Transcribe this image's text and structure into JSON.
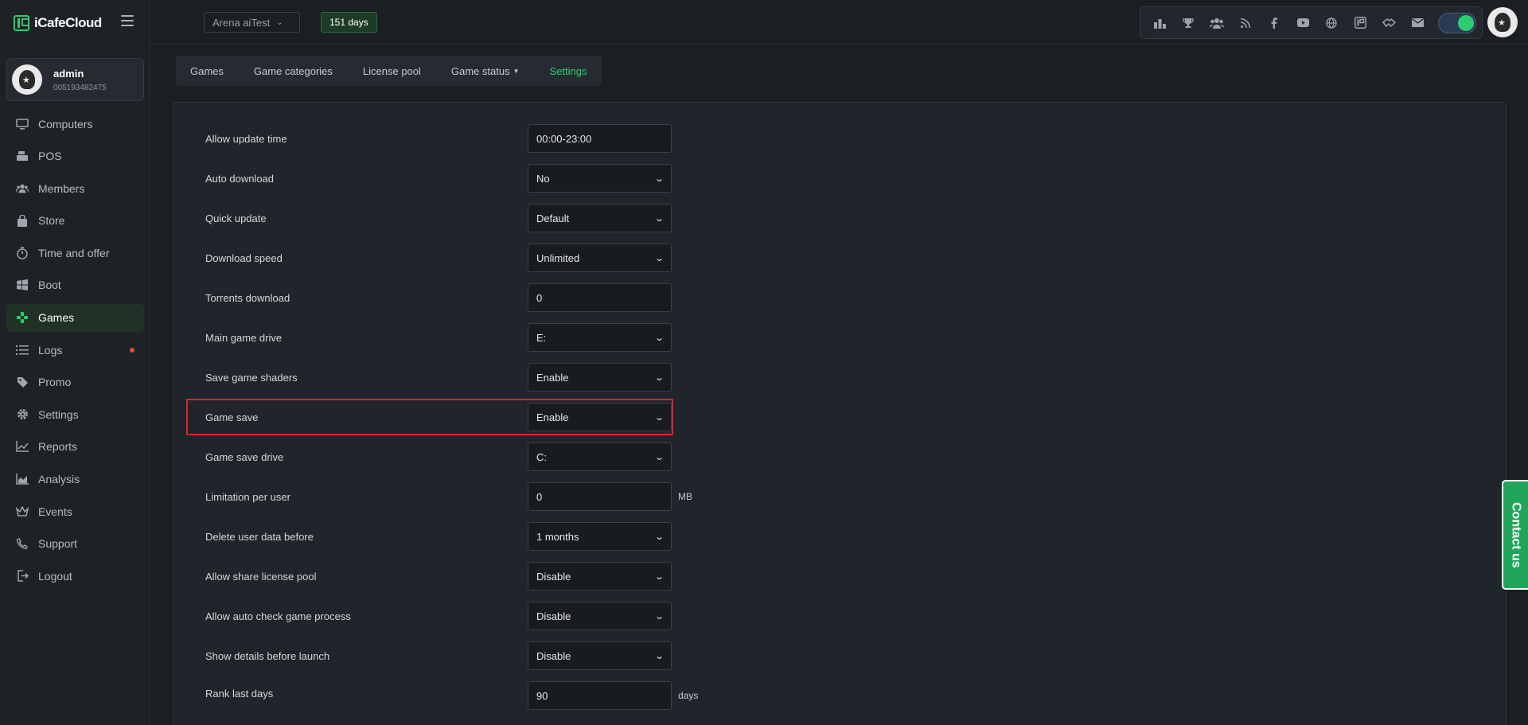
{
  "app": {
    "logo_text": "iCafeCloud"
  },
  "user": {
    "name": "admin",
    "id": "005193482475"
  },
  "sidebar": {
    "items": [
      {
        "label": "Computers",
        "icon": "monitor-icon"
      },
      {
        "label": "POS",
        "icon": "cash-register-icon"
      },
      {
        "label": "Members",
        "icon": "users-icon"
      },
      {
        "label": "Store",
        "icon": "shopping-bag-icon"
      },
      {
        "label": "Time and offer",
        "icon": "stopwatch-icon"
      },
      {
        "label": "Boot",
        "icon": "windows-icon"
      },
      {
        "label": "Games",
        "icon": "gamepad-icon",
        "active": true
      },
      {
        "label": "Logs",
        "icon": "list-icon",
        "notification_dot": true
      },
      {
        "label": "Promo",
        "icon": "tag-icon"
      },
      {
        "label": "Settings",
        "icon": "gear-icon"
      },
      {
        "label": "Reports",
        "icon": "line-chart-icon"
      },
      {
        "label": "Analysis",
        "icon": "area-chart-icon"
      },
      {
        "label": "Events",
        "icon": "crown-icon"
      },
      {
        "label": "Support",
        "icon": "phone-icon"
      },
      {
        "label": "Logout",
        "icon": "logout-icon"
      }
    ]
  },
  "header": {
    "branch": "Arena aiTest",
    "days": "151 days",
    "toolbar_icons": [
      "ranking-icon",
      "trophy-icon",
      "group-icon",
      "rss-icon",
      "facebook-icon",
      "youtube-icon",
      "globe-icon",
      "icafe-icon",
      "handshake-icon",
      "mail-icon"
    ],
    "toggle_on": true
  },
  "tabs": [
    {
      "label": "Games"
    },
    {
      "label": "Game categories"
    },
    {
      "label": "License pool"
    },
    {
      "label": "Game status",
      "dropdown": true
    },
    {
      "label": "Settings",
      "active": true
    }
  ],
  "settings": [
    {
      "label": "Allow update time",
      "value": "00:00-23:00",
      "type": "input"
    },
    {
      "label": "Auto download",
      "value": "No",
      "type": "select"
    },
    {
      "label": "Quick update",
      "value": "Default",
      "type": "select"
    },
    {
      "label": "Download speed",
      "value": "Unlimited",
      "type": "select"
    },
    {
      "label": "Torrents download",
      "value": "0",
      "type": "input"
    },
    {
      "label": "Main game drive",
      "value": "E:",
      "type": "select"
    },
    {
      "label": "Save game shaders",
      "value": "Enable",
      "type": "select"
    },
    {
      "label": "Game save",
      "value": "Enable",
      "type": "select",
      "highlighted": true
    },
    {
      "label": "Game save drive",
      "value": "C:",
      "type": "select"
    },
    {
      "label": "Limitation per user",
      "value": "0",
      "type": "input",
      "unit": "MB"
    },
    {
      "label": "Delete user data before",
      "value": "1 months",
      "type": "select"
    },
    {
      "label": "Allow share license pool",
      "value": "Disable",
      "type": "select"
    },
    {
      "label": "Allow auto check game process",
      "value": "Disable",
      "type": "select"
    },
    {
      "label": "Show details before launch",
      "value": "Disable",
      "type": "select"
    },
    {
      "label": "Rank last days",
      "value": "90",
      "type": "input",
      "unit": "days"
    }
  ],
  "contact": {
    "label": "Contact us"
  },
  "colors": {
    "accent": "#2ecc71",
    "highlight_border": "#d9232d",
    "contact_bg": "#1fa65a"
  }
}
